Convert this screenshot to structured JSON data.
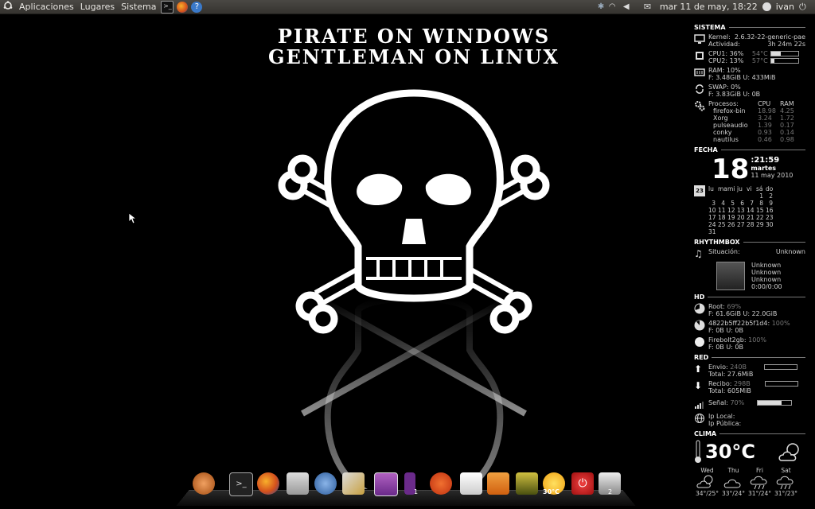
{
  "panel": {
    "menus": [
      "Aplicaciones",
      "Lugares",
      "Sistema"
    ],
    "datetime": "mar 11 de may, 18:22",
    "user": "ivan"
  },
  "wallpaper": {
    "line1": "PIRATE ON WINDOWS",
    "line2": "GENTLEMAN ON LINUX"
  },
  "conky": {
    "sistema": {
      "heading": "SISTEMA",
      "kernel_label": "Kernel:",
      "kernel": "2.6.32-22-generic-pae",
      "uptime_label": "Actividad:",
      "uptime": "3h 24m 22s",
      "cpu1": "CPU1: 36%",
      "cpu1_temp": "54°C",
      "cpu2": "CPU2: 13%",
      "cpu2_temp": "57°C",
      "ram": "RAM: 10%",
      "ram_detail": "F: 3.48GiB U: 433MiB",
      "swap": "SWAP: 0%",
      "swap_detail": "F: 3.83GiB U: 0B",
      "proc_header": [
        "Procesos:",
        "CPU",
        "RAM"
      ],
      "processes": [
        [
          "firefox-bin",
          "18.98",
          "4.25"
        ],
        [
          "Xorg",
          "3.24",
          "1.72"
        ],
        [
          "pulseaudio",
          "1.39",
          "0.17"
        ],
        [
          "conky",
          "0.93",
          "0.14"
        ],
        [
          "nautilus",
          "0.46",
          "0.98"
        ]
      ]
    },
    "fecha": {
      "heading": "FECHA",
      "day": "18",
      "time": ":21:59",
      "weekday": "martes",
      "date": "11 may 2010",
      "cal_icon": "23",
      "cal_header": [
        "lu",
        "ma",
        "mi",
        "ju",
        "vi",
        "sá",
        "do"
      ],
      "cal_days": [
        "",
        "",
        "",
        "",
        "",
        "1",
        "2",
        "3",
        "4",
        "5",
        "6",
        "7",
        "8",
        "9",
        "10",
        "11",
        "12",
        "13",
        "14",
        "15",
        "16",
        "17",
        "18",
        "19",
        "20",
        "21",
        "22",
        "23",
        "24",
        "25",
        "26",
        "27",
        "28",
        "29",
        "30",
        "31"
      ]
    },
    "rhythmbox": {
      "heading": "RHYTHMBOX",
      "status_label": "Situación:",
      "status": "Unknown",
      "lines": [
        "Unknown",
        "Unknown",
        "Unknown",
        "0:00/0:00"
      ]
    },
    "hd": {
      "heading": "HD",
      "disks": [
        {
          "name": "Root:",
          "pct": "69%",
          "detail": "F: 61.6GiB U: 22.0GiB",
          "fill": 0.69
        },
        {
          "name": "4822b5ff22b5f1d4:",
          "pct": "100%",
          "detail": "F: 0B   U: 0B",
          "fill": 1.0
        },
        {
          "name": "Firebolt2gb:",
          "pct": "100%",
          "detail": "F: 0B   U: 0B",
          "fill": 1.0
        }
      ]
    },
    "red": {
      "heading": "RED",
      "up_label": "Envio:",
      "up_rate": "240B",
      "up_total": "Total: 27.6MiB",
      "down_label": "Recibo:",
      "down_rate": "298B",
      "down_total": "Total: 605MiB",
      "signal_label": "Señal:",
      "signal": "70%",
      "signal_fill": 0.7,
      "ip_local": "Ip Local:",
      "ip_public": "Ip Pública:"
    },
    "clima": {
      "heading": "CLIMA",
      "temp": "30°C",
      "days": [
        "Wed",
        "Thu",
        "Fri",
        "Sat"
      ],
      "ranges": [
        "34°/25°",
        "33°/24°",
        "31°/24°",
        "31°/23°"
      ]
    }
  },
  "dock": {
    "items": [
      "nautilus-shell-icon",
      "terminal-icon",
      "firefox-icon",
      "calculator-icon",
      "pidgin-icon",
      "cleaner-icon",
      "window-icon",
      "app-icon",
      "ubuntu-icon",
      "editor-icon",
      "downloads-folder-icon",
      "photo-icon",
      "weather-icon",
      "shutdown-icon",
      "trash-icon"
    ],
    "badge_app": "1",
    "weather_label": "30°C",
    "trash_badge": "2"
  },
  "colors": {
    "panel": "#3f3d39",
    "background": "#000000",
    "accent": "#ffffff"
  }
}
